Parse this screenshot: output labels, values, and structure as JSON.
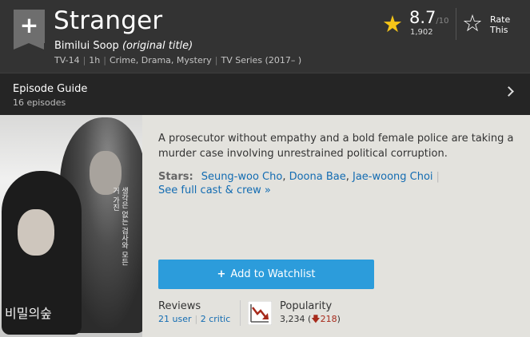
{
  "header": {
    "add_symbol": "+",
    "title": "Stranger",
    "original_title": "Bimilui Soop",
    "original_title_note": "(original title)",
    "meta": [
      "TV-14",
      "1h",
      "Crime, Drama, Mystery",
      "TV Series (2017– )"
    ],
    "rating": {
      "value": "8.7",
      "max": "/10",
      "count": "1,902"
    },
    "rate_label_1": "Rate",
    "rate_label_2": "This"
  },
  "episode_guide": {
    "title": "Episode Guide",
    "count": "16 episodes"
  },
  "poster": {
    "side_text": "생각은 없는 검사와 모든 거 가진 ",
    "title_text": "비밀의숲"
  },
  "plot": "A prosecutor without empathy and a bold female police are taking a murder case involving unrestrained political corruption.",
  "stars": {
    "label": "Stars:",
    "names": [
      "Seung-woo Cho",
      "Doona Bae",
      "Jae-woong Choi"
    ],
    "see_full": "See full cast & crew »"
  },
  "watchlist": {
    "plus": "+",
    "label": "Add to Watchlist"
  },
  "reviews": {
    "title": "Reviews",
    "user": "21 user",
    "critic": "2 critic"
  },
  "popularity": {
    "title": "Popularity",
    "value": "3,234",
    "change": "218",
    "trend": "down"
  },
  "colors": {
    "imdb_yellow": "#f5c518",
    "link_blue": "#136cb2",
    "watchlist_blue": "#2c9cdb",
    "down_red": "#a72a1b"
  }
}
